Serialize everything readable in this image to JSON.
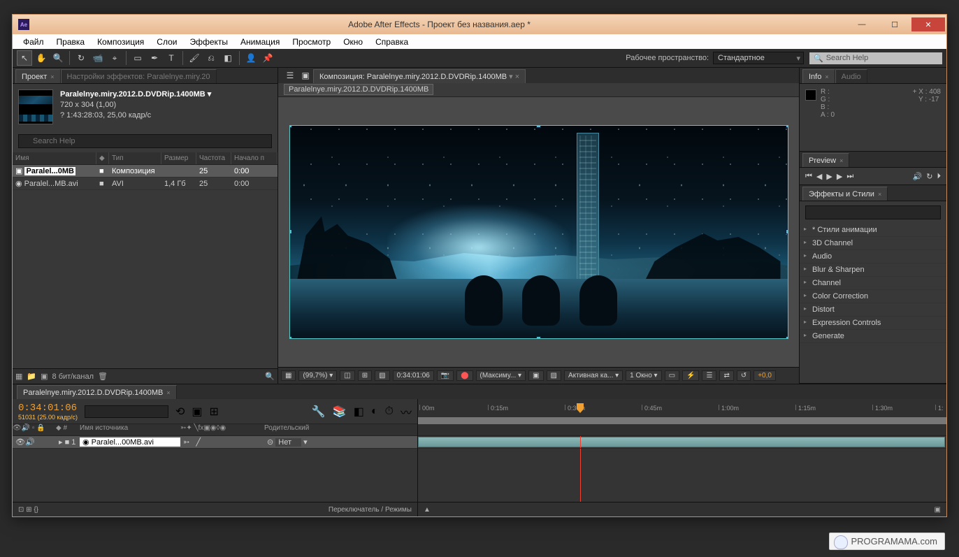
{
  "titlebar": {
    "app_icon": "Ae",
    "title": "Adobe After Effects - Проект без названия.aep *"
  },
  "menubar": [
    "Файл",
    "Правка",
    "Композиция",
    "Слои",
    "Эффекты",
    "Анимация",
    "Просмотр",
    "Окно",
    "Справка"
  ],
  "toolbar": {
    "workspace_label": "Рабочее пространство:",
    "workspace_value": "Стандартное",
    "search_placeholder": "Search Help"
  },
  "project": {
    "tab": "Проект",
    "fx_tab": "Настройки эффектов: Paralelnye.miry.20",
    "clip_name": "Paralelnye.miry.2012.D.DVDRip.1400MB ▾",
    "clip_dims": "720 x 304 (1,00)",
    "clip_dur": "? 1:43:28:03, 25,00 кадр/с",
    "cols": {
      "name": "Имя",
      "type": "Тип",
      "size": "Размер",
      "rate": "Частота",
      "start": "Начало п"
    },
    "rows": [
      {
        "name": "Paralel...0MB",
        "type": "Композиция",
        "size": "",
        "rate": "25",
        "start": "0:00"
      },
      {
        "name": "Paralel...MB.avi",
        "type": "AVI",
        "size": "1,4 Гб",
        "rate": "25",
        "start": "0:00"
      }
    ],
    "bpc": "8 бит/канал"
  },
  "comp": {
    "tab_prefix": "Композиция: ",
    "tab_name": "Paralelnye.miry.2012.D.DVDRip.1400MB",
    "bread": "Paralelnye.miry.2012.D.DVDRip.1400MB",
    "zoom": "(99,7%)",
    "timecode": "0:34:01:06",
    "res": "(Максиму...",
    "camera": "Активная ка...",
    "views": "1 Окно",
    "expgain": "+0,0"
  },
  "info": {
    "tab1": "Info",
    "tab2": "Audio",
    "r": "R :",
    "g": "G :",
    "b": "B :",
    "a": "A : 0",
    "x": "X : 408",
    "y": "Y : -17"
  },
  "preview": {
    "tab": "Preview"
  },
  "effects": {
    "tab": "Эффекты и Стили",
    "items": [
      "* Стили анимации",
      "3D Channel",
      "Audio",
      "Blur & Sharpen",
      "Channel",
      "Color Correction",
      "Distort",
      "Expression Controls",
      "Generate"
    ]
  },
  "timeline": {
    "tab": "Paralelnye.miry.2012.D.DVDRip.1400MB",
    "tc": "0:34:01:06",
    "fps": "51031 (25.00 кадр/с)",
    "source_col": "Имя источника",
    "parent_col": "Родительский",
    "layer_num": "1",
    "layer_name": "Paralel...00MB.avi",
    "parent_val": "Нет",
    "ruler": [
      "00m",
      "0:15m",
      "0:30m",
      "0:45m",
      "1:00m",
      "1:15m",
      "1:30m",
      "1:"
    ],
    "switch_label": "Переключатель / Режимы"
  },
  "watermark": "PROGRAMAMA.com"
}
